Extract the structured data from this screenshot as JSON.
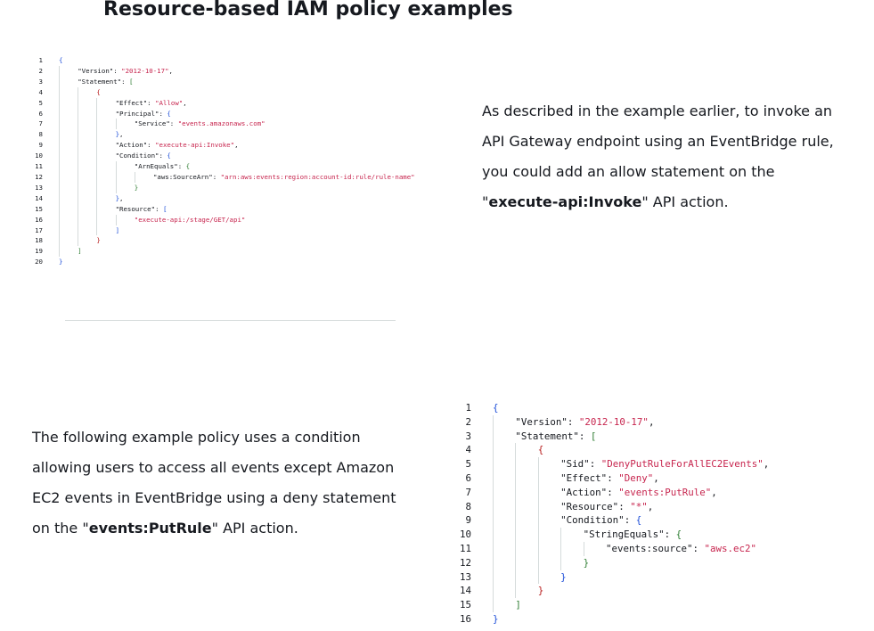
{
  "title": "Resource-based IAM policy examples",
  "colors": {
    "text": "#16191f",
    "string": "#c7254e",
    "bracket_level_1": "#1d4ed8",
    "bracket_level_2": "#2e7d32",
    "bracket_level_3": "#b71c1c",
    "indent_guide": "#d5dbdb",
    "divider": "#d5dbdb"
  },
  "policy_1": {
    "lines": [
      {
        "num": "1",
        "indent": 0,
        "parts": [
          {
            "t": "{",
            "c": "b1"
          }
        ]
      },
      {
        "num": "2",
        "indent": 1,
        "parts": [
          {
            "t": "\"Version\"",
            "c": "k"
          },
          {
            "t": ": ",
            "c": "p"
          },
          {
            "t": "\"2012-10-17\"",
            "c": "s"
          },
          {
            "t": ",",
            "c": "p"
          }
        ]
      },
      {
        "num": "3",
        "indent": 1,
        "parts": [
          {
            "t": "\"Statement\"",
            "c": "k"
          },
          {
            "t": ": ",
            "c": "p"
          },
          {
            "t": "[",
            "c": "b2"
          }
        ]
      },
      {
        "num": "4",
        "indent": 2,
        "parts": [
          {
            "t": "{",
            "c": "b3"
          }
        ]
      },
      {
        "num": "5",
        "indent": 3,
        "parts": [
          {
            "t": "\"Effect\"",
            "c": "k"
          },
          {
            "t": ": ",
            "c": "p"
          },
          {
            "t": "\"Allow\"",
            "c": "s"
          },
          {
            "t": ",",
            "c": "p"
          }
        ]
      },
      {
        "num": "6",
        "indent": 3,
        "parts": [
          {
            "t": "\"Principal\"",
            "c": "k"
          },
          {
            "t": ": ",
            "c": "p"
          },
          {
            "t": "{",
            "c": "b1"
          }
        ]
      },
      {
        "num": "7",
        "indent": 4,
        "parts": [
          {
            "t": "\"Service\"",
            "c": "k"
          },
          {
            "t": ": ",
            "c": "p"
          },
          {
            "t": "\"events.amazonaws.com\"",
            "c": "s"
          }
        ]
      },
      {
        "num": "8",
        "indent": 3,
        "parts": [
          {
            "t": "}",
            "c": "b1"
          },
          {
            "t": ",",
            "c": "p"
          }
        ]
      },
      {
        "num": "9",
        "indent": 3,
        "parts": [
          {
            "t": "\"Action\"",
            "c": "k"
          },
          {
            "t": ": ",
            "c": "p"
          },
          {
            "t": "\"execute-api:Invoke\"",
            "c": "s"
          },
          {
            "t": ",",
            "c": "p"
          }
        ]
      },
      {
        "num": "10",
        "indent": 3,
        "parts": [
          {
            "t": "\"Condition\"",
            "c": "k"
          },
          {
            "t": ": ",
            "c": "p"
          },
          {
            "t": "{",
            "c": "b1"
          }
        ]
      },
      {
        "num": "11",
        "indent": 4,
        "parts": [
          {
            "t": "\"ArnEquals\"",
            "c": "k"
          },
          {
            "t": ": ",
            "c": "p"
          },
          {
            "t": "{",
            "c": "b2"
          }
        ]
      },
      {
        "num": "12",
        "indent": 5,
        "parts": [
          {
            "t": "\"aws:SourceArn\"",
            "c": "k"
          },
          {
            "t": ": ",
            "c": "p"
          },
          {
            "t": "\"arn:aws:events:region:account-id:rule/rule-name\"",
            "c": "s"
          }
        ]
      },
      {
        "num": "13",
        "indent": 4,
        "parts": [
          {
            "t": "}",
            "c": "b2"
          }
        ]
      },
      {
        "num": "14",
        "indent": 3,
        "parts": [
          {
            "t": "}",
            "c": "b1"
          },
          {
            "t": ",",
            "c": "p"
          }
        ]
      },
      {
        "num": "15",
        "indent": 3,
        "parts": [
          {
            "t": "\"Resource\"",
            "c": "k"
          },
          {
            "t": ": ",
            "c": "p"
          },
          {
            "t": "[",
            "c": "b1"
          }
        ]
      },
      {
        "num": "16",
        "indent": 4,
        "parts": [
          {
            "t": "\"execute-api:/stage/GET/api\"",
            "c": "s"
          }
        ]
      },
      {
        "num": "17",
        "indent": 3,
        "parts": [
          {
            "t": "]",
            "c": "b1"
          }
        ]
      },
      {
        "num": "18",
        "indent": 2,
        "parts": [
          {
            "t": "}",
            "c": "b3"
          }
        ]
      },
      {
        "num": "19",
        "indent": 1,
        "parts": [
          {
            "t": "]",
            "c": "b2"
          }
        ]
      },
      {
        "num": "20",
        "indent": 0,
        "parts": [
          {
            "t": "}",
            "c": "b1"
          }
        ]
      }
    ]
  },
  "paragraph_1": {
    "text_before": "As described in the example earlier, to invoke an API Gateway endpoint using an EventBridge rule, you could add an allow statement on the \"",
    "bold": "execute-api:Invoke",
    "text_after": "\" API action."
  },
  "paragraph_2": {
    "text_before": "The following example policy uses a condition allowing users to access all events except Amazon EC2 events in EventBridge using a deny statement on the \"",
    "bold": "events:PutRule",
    "text_after": "\" API action."
  },
  "policy_2": {
    "lines": [
      {
        "num": "1",
        "indent": 0,
        "parts": [
          {
            "t": "{",
            "c": "b1"
          }
        ]
      },
      {
        "num": "2",
        "indent": 1,
        "parts": [
          {
            "t": "\"Version\"",
            "c": "k"
          },
          {
            "t": ": ",
            "c": "p"
          },
          {
            "t": "\"2012-10-17\"",
            "c": "s"
          },
          {
            "t": ",",
            "c": "p"
          }
        ]
      },
      {
        "num": "3",
        "indent": 1,
        "parts": [
          {
            "t": "\"Statement\"",
            "c": "k"
          },
          {
            "t": ": ",
            "c": "p"
          },
          {
            "t": "[",
            "c": "b2"
          }
        ]
      },
      {
        "num": "4",
        "indent": 2,
        "parts": [
          {
            "t": "{",
            "c": "b3"
          }
        ]
      },
      {
        "num": "5",
        "indent": 3,
        "parts": [
          {
            "t": "\"Sid\"",
            "c": "k"
          },
          {
            "t": ": ",
            "c": "p"
          },
          {
            "t": "\"DenyPutRuleForAllEC2Events\"",
            "c": "s"
          },
          {
            "t": ",",
            "c": "p"
          }
        ]
      },
      {
        "num": "6",
        "indent": 3,
        "parts": [
          {
            "t": "\"Effect\"",
            "c": "k"
          },
          {
            "t": ": ",
            "c": "p"
          },
          {
            "t": "\"Deny\"",
            "c": "s"
          },
          {
            "t": ",",
            "c": "p"
          }
        ]
      },
      {
        "num": "7",
        "indent": 3,
        "parts": [
          {
            "t": "\"Action\"",
            "c": "k"
          },
          {
            "t": ": ",
            "c": "p"
          },
          {
            "t": "\"events:PutRule\"",
            "c": "s"
          },
          {
            "t": ",",
            "c": "p"
          }
        ]
      },
      {
        "num": "8",
        "indent": 3,
        "parts": [
          {
            "t": "\"Resource\"",
            "c": "k"
          },
          {
            "t": ": ",
            "c": "p"
          },
          {
            "t": "\"*\"",
            "c": "s"
          },
          {
            "t": ",",
            "c": "p"
          }
        ]
      },
      {
        "num": "9",
        "indent": 3,
        "parts": [
          {
            "t": "\"Condition\"",
            "c": "k"
          },
          {
            "t": ": ",
            "c": "p"
          },
          {
            "t": "{",
            "c": "b1"
          }
        ]
      },
      {
        "num": "10",
        "indent": 4,
        "parts": [
          {
            "t": "\"StringEquals\"",
            "c": "k"
          },
          {
            "t": ": ",
            "c": "p"
          },
          {
            "t": "{",
            "c": "b2"
          }
        ]
      },
      {
        "num": "11",
        "indent": 5,
        "parts": [
          {
            "t": "\"events:source\"",
            "c": "k"
          },
          {
            "t": ": ",
            "c": "p"
          },
          {
            "t": "\"aws.ec2\"",
            "c": "s"
          }
        ]
      },
      {
        "num": "12",
        "indent": 4,
        "parts": [
          {
            "t": "}",
            "c": "b2"
          }
        ]
      },
      {
        "num": "13",
        "indent": 3,
        "parts": [
          {
            "t": "}",
            "c": "b1"
          }
        ]
      },
      {
        "num": "14",
        "indent": 2,
        "parts": [
          {
            "t": "}",
            "c": "b3"
          }
        ]
      },
      {
        "num": "15",
        "indent": 1,
        "parts": [
          {
            "t": "]",
            "c": "b2"
          }
        ]
      },
      {
        "num": "16",
        "indent": 0,
        "parts": [
          {
            "t": "}",
            "c": "b1"
          }
        ]
      }
    ]
  }
}
